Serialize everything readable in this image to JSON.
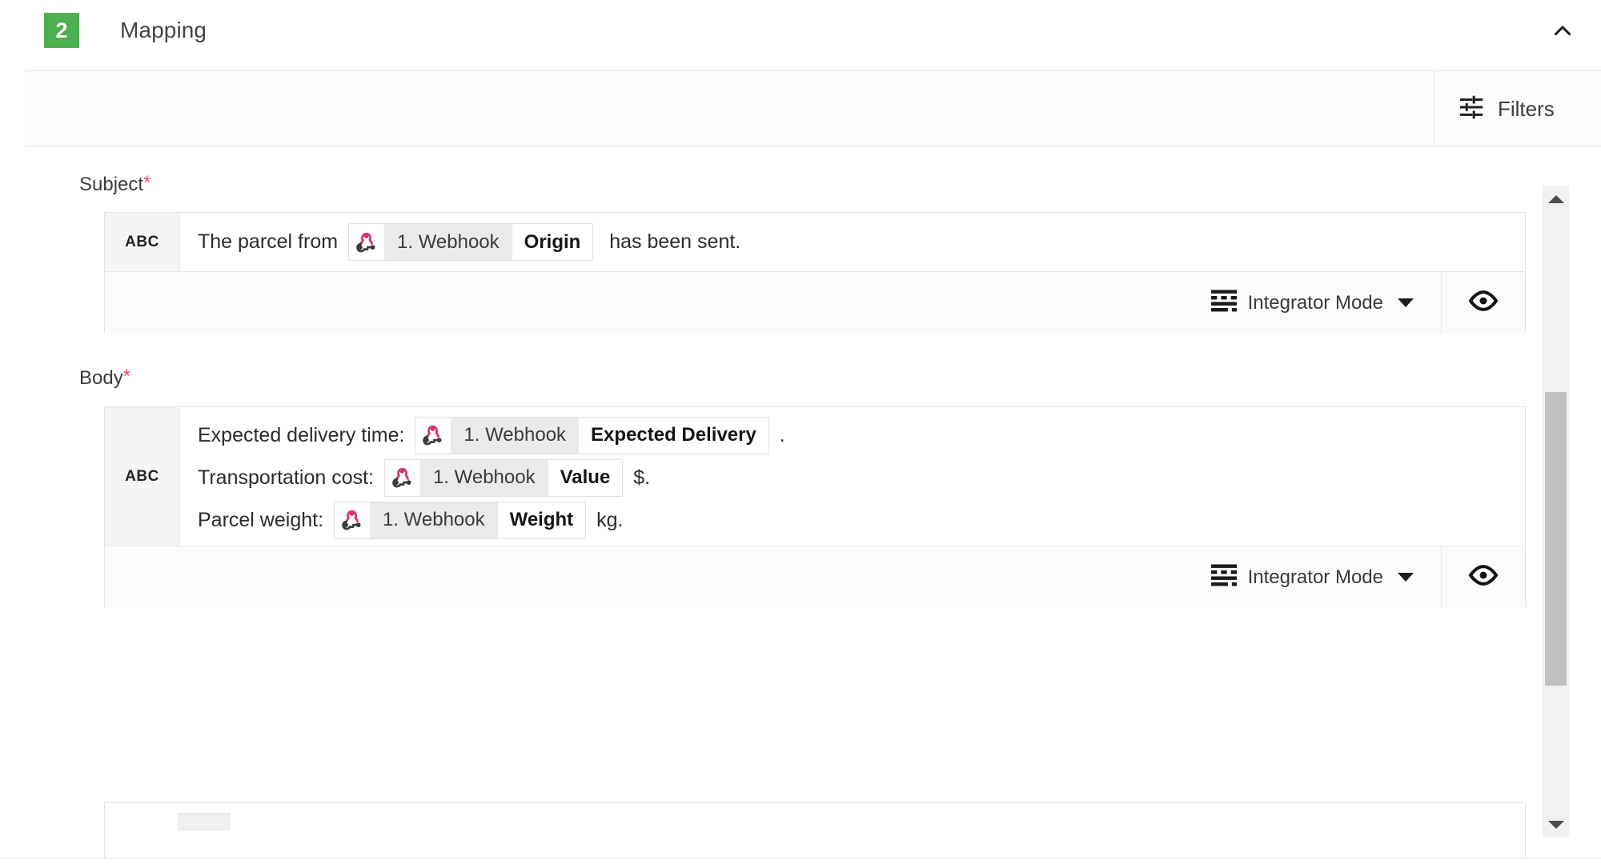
{
  "header": {
    "step_number": "2",
    "title": "Mapping",
    "badge_color": "#4caf50",
    "collapse_icon": "chevron-up-icon"
  },
  "toolbar": {
    "filters_label": "Filters",
    "filters_icon": "tune-sliders-icon"
  },
  "fields": [
    {
      "label": "Subject",
      "required_marker": "*",
      "type_badge": "ABC",
      "lines": [
        {
          "parts": [
            {
              "kind": "text",
              "text": "The parcel from "
            },
            {
              "kind": "pill",
              "icon": "webhook-icon",
              "module": "1. Webhook",
              "field": "Origin"
            },
            {
              "kind": "text",
              "text": "  has been sent."
            }
          ]
        }
      ],
      "footer": {
        "mode_label": "Integrator Mode",
        "mode_icon": "text-lines-icon",
        "caret_icon": "caret-down-icon",
        "preview_icon": "eye-icon"
      }
    },
    {
      "label": "Body",
      "required_marker": "*",
      "type_badge": "ABC",
      "lines": [
        {
          "parts": [
            {
              "kind": "text",
              "text": "Expected delivery time: "
            },
            {
              "kind": "pill",
              "icon": "webhook-icon",
              "module": "1. Webhook",
              "field": "Expected Delivery"
            },
            {
              "kind": "text",
              "text": " ."
            }
          ]
        },
        {
          "parts": [
            {
              "kind": "text",
              "text": "Transportation cost: "
            },
            {
              "kind": "pill",
              "icon": "webhook-icon",
              "module": "1. Webhook",
              "field": "Value"
            },
            {
              "kind": "text",
              "text": " $."
            }
          ]
        },
        {
          "parts": [
            {
              "kind": "text",
              "text": "Parcel weight: "
            },
            {
              "kind": "pill",
              "icon": "webhook-icon",
              "module": "1. Webhook",
              "field": "Weight"
            },
            {
              "kind": "text",
              "text": " kg."
            }
          ]
        }
      ],
      "footer": {
        "mode_label": "Integrator Mode",
        "mode_icon": "text-lines-icon",
        "caret_icon": "caret-down-icon",
        "preview_icon": "eye-icon"
      }
    }
  ],
  "scrollbar": {
    "up_icon": "triangle-up-icon",
    "down_icon": "triangle-down-icon"
  },
  "colors": {
    "accent_green": "#4caf50",
    "required_red": "#f44a5e",
    "webhook_pink": "#d6336c",
    "webhook_dark": "#3b3b3b"
  }
}
